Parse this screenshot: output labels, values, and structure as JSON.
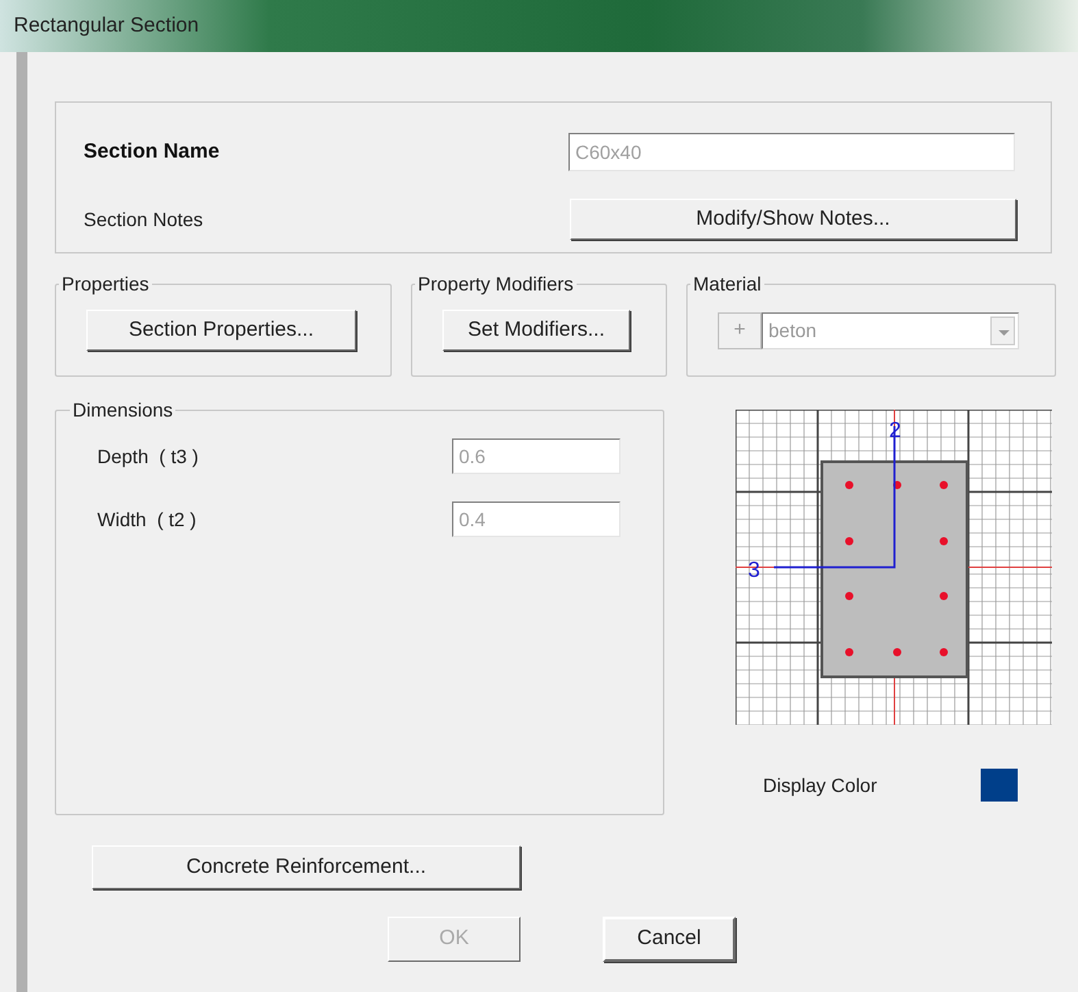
{
  "window": {
    "title": "Rectangular Section"
  },
  "section_name": {
    "label": "Section Name",
    "value": "C60x40",
    "disabled": true
  },
  "section_notes": {
    "label": "Section Notes",
    "button": "Modify/Show Notes..."
  },
  "properties": {
    "title": "Properties",
    "button": "Section Properties..."
  },
  "property_modifiers": {
    "title": "Property Modifiers",
    "button": "Set Modifiers..."
  },
  "material": {
    "title": "Material",
    "plus_button": "+",
    "value": "beton"
  },
  "dimensions": {
    "title": "Dimensions",
    "fields": [
      {
        "label": "Depth  ( t3 )",
        "value": "0.6",
        "disabled": true
      },
      {
        "label": "Width  ( t2 )",
        "value": "0.4",
        "disabled": true
      }
    ]
  },
  "section_drawing": {
    "axis_labels": [
      "2",
      "3"
    ]
  },
  "display_color": {
    "label": "Display Color",
    "color": "#003f8a"
  },
  "reinforcement_button": "Concrete Reinforcement...",
  "buttons": [
    {
      "label": "OK",
      "disabled": true
    },
    {
      "label": "Cancel",
      "disabled": false
    }
  ]
}
